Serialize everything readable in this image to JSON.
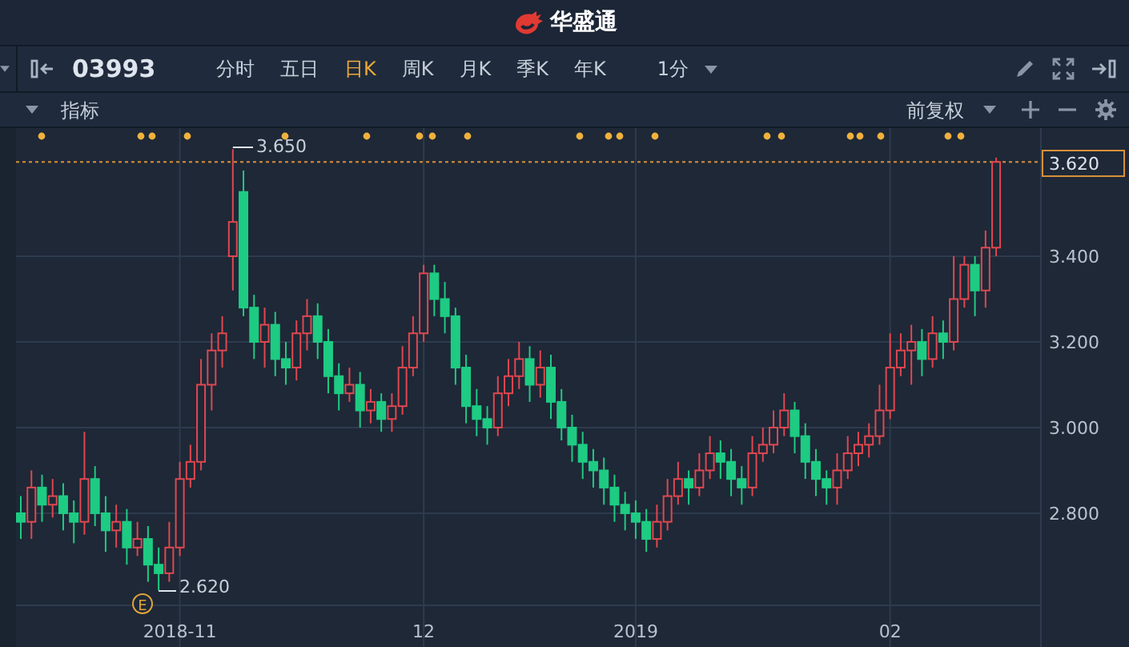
{
  "header": {
    "logo_text": "华盛通"
  },
  "toolbar": {
    "symbol": "03993",
    "periods": [
      {
        "label": "分时",
        "selected": false
      },
      {
        "label": "五日",
        "selected": false
      },
      {
        "label": "日K",
        "selected": true
      },
      {
        "label": "周K",
        "selected": false
      },
      {
        "label": "月K",
        "selected": false
      },
      {
        "label": "季K",
        "selected": false
      },
      {
        "label": "年K",
        "selected": false
      }
    ],
    "interval": "1分"
  },
  "indicator_bar": {
    "label": "指标",
    "adjustment": "前复权"
  },
  "chart": {
    "current_price": "3.620",
    "high_label": "3.650",
    "low_label": "2.620",
    "event_marker": "E",
    "chart_data": {
      "type": "candlestick",
      "categories": [
        null,
        null,
        null,
        null,
        null,
        null,
        null,
        null,
        null,
        null,
        null,
        null,
        null,
        null,
        null,
        "2018-11",
        null,
        null,
        null,
        null,
        null,
        null,
        null,
        null,
        null,
        null,
        null,
        null,
        null,
        null,
        null,
        null,
        null,
        null,
        null,
        null,
        null,
        null,
        "12",
        null,
        null,
        null,
        null,
        null,
        null,
        null,
        null,
        null,
        null,
        null,
        null,
        null,
        null,
        null,
        null,
        null,
        null,
        null,
        "2019",
        null,
        null,
        null,
        null,
        null,
        null,
        null,
        null,
        null,
        null,
        null,
        null,
        null,
        null,
        null,
        null,
        null,
        null,
        null,
        null,
        null,
        null,
        null,
        "02",
        null,
        null,
        null,
        null,
        null,
        null,
        null,
        null,
        null,
        null
      ],
      "ohlc": [
        [
          2.8,
          2.84,
          2.74,
          2.78
        ],
        [
          2.78,
          2.9,
          2.74,
          2.86
        ],
        [
          2.86,
          2.89,
          2.78,
          2.82
        ],
        [
          2.82,
          2.88,
          2.79,
          2.84
        ],
        [
          2.84,
          2.87,
          2.76,
          2.8
        ],
        [
          2.8,
          2.83,
          2.73,
          2.78
        ],
        [
          2.78,
          2.99,
          2.75,
          2.88
        ],
        [
          2.88,
          2.91,
          2.77,
          2.8
        ],
        [
          2.8,
          2.84,
          2.71,
          2.76
        ],
        [
          2.76,
          2.82,
          2.72,
          2.78
        ],
        [
          2.78,
          2.81,
          2.68,
          2.72
        ],
        [
          2.72,
          2.78,
          2.7,
          2.74
        ],
        [
          2.74,
          2.77,
          2.64,
          2.68
        ],
        [
          2.68,
          2.72,
          2.62,
          2.66
        ],
        [
          2.66,
          2.78,
          2.64,
          2.72
        ],
        [
          2.72,
          2.92,
          2.7,
          2.88
        ],
        [
          2.88,
          2.96,
          2.86,
          2.92
        ],
        [
          2.92,
          3.16,
          2.9,
          3.1
        ],
        [
          3.1,
          3.22,
          3.04,
          3.18
        ],
        [
          3.18,
          3.26,
          3.14,
          3.22
        ],
        [
          3.4,
          3.65,
          3.32,
          3.48
        ],
        [
          3.55,
          3.6,
          3.26,
          3.28
        ],
        [
          3.28,
          3.31,
          3.16,
          3.2
        ],
        [
          3.2,
          3.28,
          3.14,
          3.24
        ],
        [
          3.24,
          3.27,
          3.12,
          3.16
        ],
        [
          3.16,
          3.2,
          3.1,
          3.14
        ],
        [
          3.14,
          3.25,
          3.11,
          3.22
        ],
        [
          3.22,
          3.3,
          3.18,
          3.26
        ],
        [
          3.26,
          3.29,
          3.16,
          3.2
        ],
        [
          3.2,
          3.23,
          3.08,
          3.12
        ],
        [
          3.12,
          3.15,
          3.04,
          3.08
        ],
        [
          3.08,
          3.14,
          3.06,
          3.1
        ],
        [
          3.1,
          3.13,
          3.0,
          3.04
        ],
        [
          3.04,
          3.09,
          3.01,
          3.06
        ],
        [
          3.06,
          3.08,
          2.99,
          3.02
        ],
        [
          3.02,
          3.08,
          2.99,
          3.05
        ],
        [
          3.05,
          3.19,
          3.03,
          3.14
        ],
        [
          3.14,
          3.26,
          3.12,
          3.22
        ],
        [
          3.22,
          3.38,
          3.2,
          3.36
        ],
        [
          3.36,
          3.38,
          3.26,
          3.3
        ],
        [
          3.3,
          3.34,
          3.22,
          3.26
        ],
        [
          3.26,
          3.28,
          3.1,
          3.14
        ],
        [
          3.14,
          3.17,
          3.01,
          3.05
        ],
        [
          3.05,
          3.09,
          2.98,
          3.02
        ],
        [
          3.02,
          3.05,
          2.96,
          3.0
        ],
        [
          3.0,
          3.12,
          2.98,
          3.08
        ],
        [
          3.08,
          3.16,
          3.05,
          3.12
        ],
        [
          3.12,
          3.2,
          3.09,
          3.16
        ],
        [
          3.16,
          3.19,
          3.06,
          3.1
        ],
        [
          3.1,
          3.18,
          3.07,
          3.14
        ],
        [
          3.14,
          3.17,
          3.02,
          3.06
        ],
        [
          3.06,
          3.09,
          2.97,
          3.0
        ],
        [
          3.0,
          3.03,
          2.92,
          2.96
        ],
        [
          2.96,
          2.99,
          2.88,
          2.92
        ],
        [
          2.92,
          2.95,
          2.86,
          2.9
        ],
        [
          2.9,
          2.93,
          2.82,
          2.86
        ],
        [
          2.86,
          2.89,
          2.78,
          2.82
        ],
        [
          2.82,
          2.85,
          2.76,
          2.8
        ],
        [
          2.8,
          2.83,
          2.74,
          2.78
        ],
        [
          2.78,
          2.81,
          2.71,
          2.74
        ],
        [
          2.74,
          2.82,
          2.72,
          2.78
        ],
        [
          2.78,
          2.88,
          2.76,
          2.84
        ],
        [
          2.84,
          2.92,
          2.82,
          2.88
        ],
        [
          2.88,
          2.9,
          2.82,
          2.86
        ],
        [
          2.86,
          2.94,
          2.84,
          2.9
        ],
        [
          2.9,
          2.98,
          2.88,
          2.94
        ],
        [
          2.94,
          2.97,
          2.88,
          2.92
        ],
        [
          2.92,
          2.95,
          2.84,
          2.88
        ],
        [
          2.88,
          2.91,
          2.82,
          2.86
        ],
        [
          2.86,
          2.98,
          2.84,
          2.94
        ],
        [
          2.94,
          3.0,
          2.92,
          2.96
        ],
        [
          2.96,
          3.04,
          2.94,
          3.0
        ],
        [
          3.0,
          3.08,
          2.98,
          3.04
        ],
        [
          3.04,
          3.06,
          2.94,
          2.98
        ],
        [
          2.98,
          3.01,
          2.88,
          2.92
        ],
        [
          2.92,
          2.95,
          2.84,
          2.88
        ],
        [
          2.88,
          2.9,
          2.82,
          2.86
        ],
        [
          2.86,
          2.94,
          2.82,
          2.9
        ],
        [
          2.9,
          2.98,
          2.88,
          2.94
        ],
        [
          2.94,
          2.99,
          2.91,
          2.96
        ],
        [
          2.96,
          3.01,
          2.93,
          2.98
        ],
        [
          2.98,
          3.1,
          2.96,
          3.04
        ],
        [
          3.04,
          3.22,
          3.02,
          3.14
        ],
        [
          3.14,
          3.22,
          3.12,
          3.18
        ],
        [
          3.18,
          3.24,
          3.1,
          3.2
        ],
        [
          3.2,
          3.23,
          3.12,
          3.16
        ],
        [
          3.16,
          3.26,
          3.14,
          3.22
        ],
        [
          3.22,
          3.25,
          3.16,
          3.2
        ],
        [
          3.2,
          3.4,
          3.18,
          3.3
        ],
        [
          3.3,
          3.4,
          3.28,
          3.38
        ],
        [
          3.38,
          3.4,
          3.26,
          3.32
        ],
        [
          3.32,
          3.46,
          3.28,
          3.42
        ],
        [
          3.42,
          3.63,
          3.4,
          3.62
        ]
      ],
      "ylim": [
        2.585,
        3.699
      ],
      "grid": true,
      "ref_lines": [
        {
          "axis": "y",
          "value": 3.62
        }
      ],
      "yticks": [
        {
          "value": 2.8,
          "label": "2.800"
        },
        {
          "value": 3.0,
          "label": "3.000"
        },
        {
          "value": 3.2,
          "label": "3.200"
        },
        {
          "value": 3.4,
          "label": "3.400"
        }
      ]
    }
  }
}
